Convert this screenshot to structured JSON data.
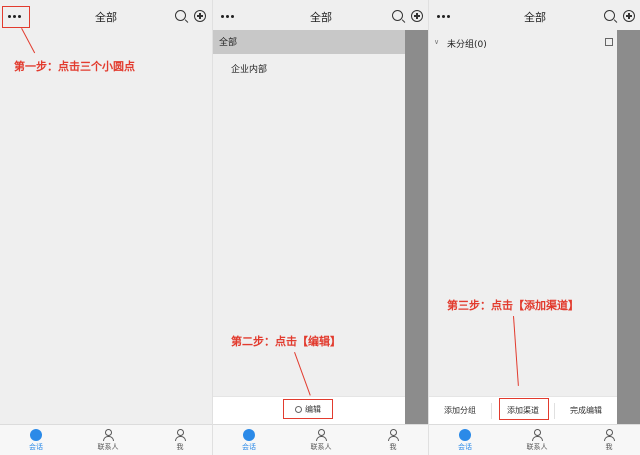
{
  "panel1": {
    "title": "全部",
    "annotation": "第一步：点击三个小圆点"
  },
  "panel2": {
    "title": "全部",
    "menu_selected": "全部",
    "menu_item": "企业内部",
    "edit_label": "编辑",
    "annotation": "第二步：点击【编辑】"
  },
  "panel3": {
    "title": "全部",
    "group_label": "未分组(0)",
    "actions": [
      "添加分组",
      "添加渠道",
      "完成编辑"
    ],
    "annotation": "第三步：点击【添加渠道】"
  },
  "tabs": [
    "会话",
    "联系人",
    "我"
  ],
  "colors": {
    "accent": "#2b8ae8",
    "annotation": "#e23b2e",
    "strip": "#8c8c8c"
  },
  "icons": [
    "more-dots-icon",
    "search-icon",
    "add-circle-icon",
    "chat-icon",
    "contacts-icon",
    "me-icon",
    "gear-icon",
    "edit-square-icon",
    "chevron-down-icon"
  ]
}
